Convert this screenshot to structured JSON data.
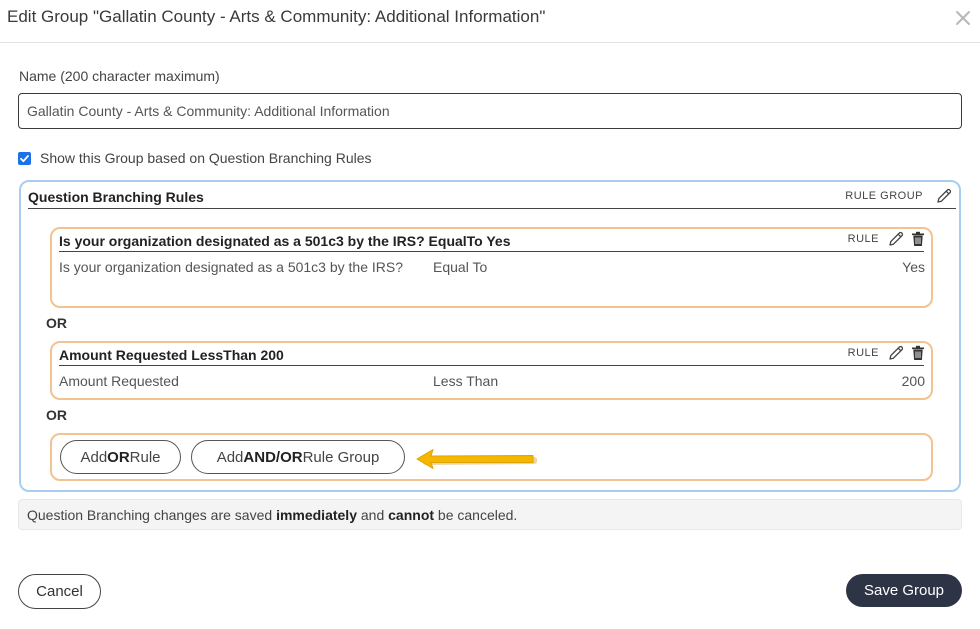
{
  "modal": {
    "title": "Edit Group \"Gallatin County - Arts & Community: Additional Information\"",
    "close_icon": "close-icon"
  },
  "form": {
    "name_label": "Name (200 character maximum)",
    "name_value": "Gallatin County - Arts & Community: Additional Information",
    "show_checked": true,
    "show_label": "Show this Group based on Question Branching Rules"
  },
  "branching": {
    "title": "Question Branching Rules",
    "group_tag": "RULE GROUP",
    "connector": "OR",
    "rules": [
      {
        "title": "Is your organization designated as a 501c3 by the IRS? EqualTo Yes",
        "tag": "RULE",
        "question": "Is your organization designated as a 501c3 by the IRS?",
        "operator": "Equal To",
        "value": "Yes"
      },
      {
        "title": "Amount Requested LessThan 200",
        "tag": "RULE",
        "question": "Amount Requested",
        "operator": "Less Than",
        "value": "200"
      }
    ],
    "add_or_rule": {
      "pre": "Add ",
      "bold": "OR",
      "post": " Rule"
    },
    "add_rule_group": {
      "pre": "Add ",
      "bold": "AND/OR",
      "post": " Rule Group"
    }
  },
  "notice": {
    "part1": "Question Branching changes are saved ",
    "bold1": "immediately",
    "part2": " and ",
    "bold2": "cannot",
    "part3": " be canceled."
  },
  "footer": {
    "cancel_label": "Cancel",
    "save_label": "Save Group"
  },
  "colors": {
    "group_border": "#a9cdf0",
    "rule_border": "#f2c391",
    "primary_button": "#2d3446",
    "arrow": "#f5b700",
    "checkbox": "#1a73e8"
  }
}
